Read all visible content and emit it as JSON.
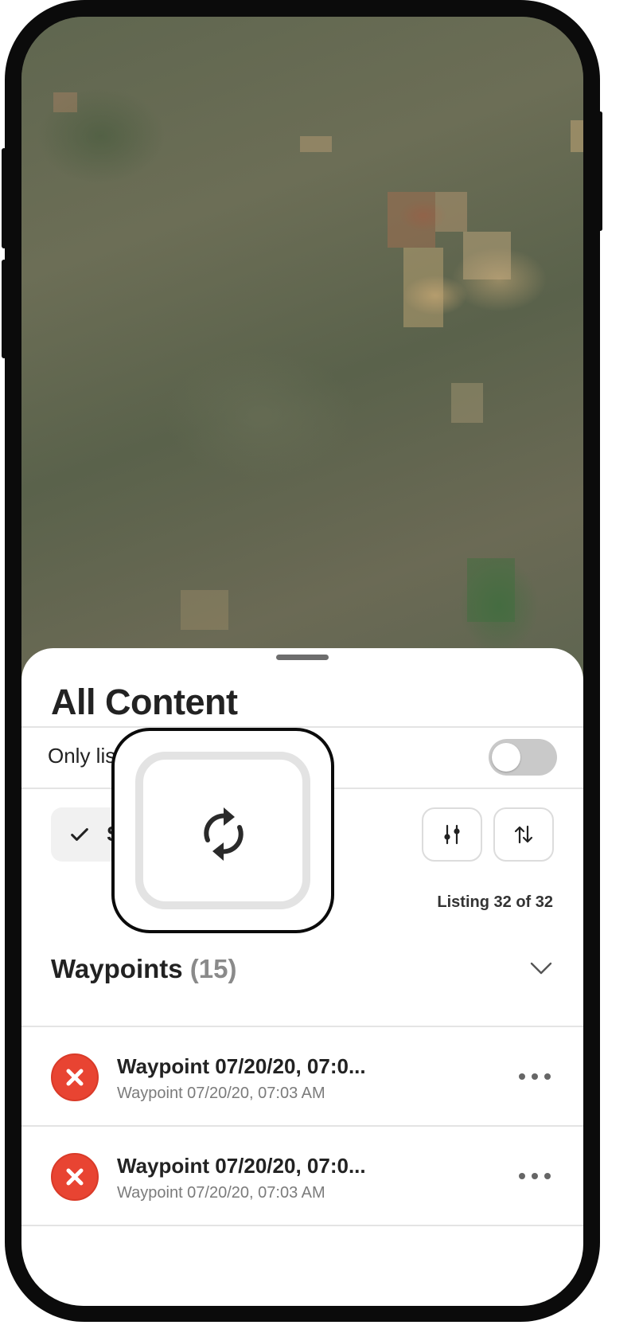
{
  "map": {
    "label": ""
  },
  "sheet": {
    "title": "All Content",
    "only_toggle": {
      "label": "Only list content on screen",
      "on": false
    },
    "select_chip": {
      "label": "S"
    },
    "filter_icon": "sliders-icon",
    "sort_icon": "sort-arrows-icon",
    "listing_text": "Listing 32 of 32",
    "section": {
      "title": "Waypoints",
      "count": "(15)"
    },
    "items": [
      {
        "title": "Waypoint 07/20/20, 07:0...",
        "subtitle": "Waypoint 07/20/20, 07:03 AM",
        "status_icon": "red-x-icon"
      },
      {
        "title": "Waypoint 07/20/20, 07:0...",
        "subtitle": "Waypoint 07/20/20, 07:03 AM",
        "status_icon": "red-x-icon"
      }
    ]
  },
  "popup": {
    "icon": "sync-refresh-icon"
  },
  "colors": {
    "accent_red": "#e84432",
    "toggle_off": "#c9c9c9"
  }
}
